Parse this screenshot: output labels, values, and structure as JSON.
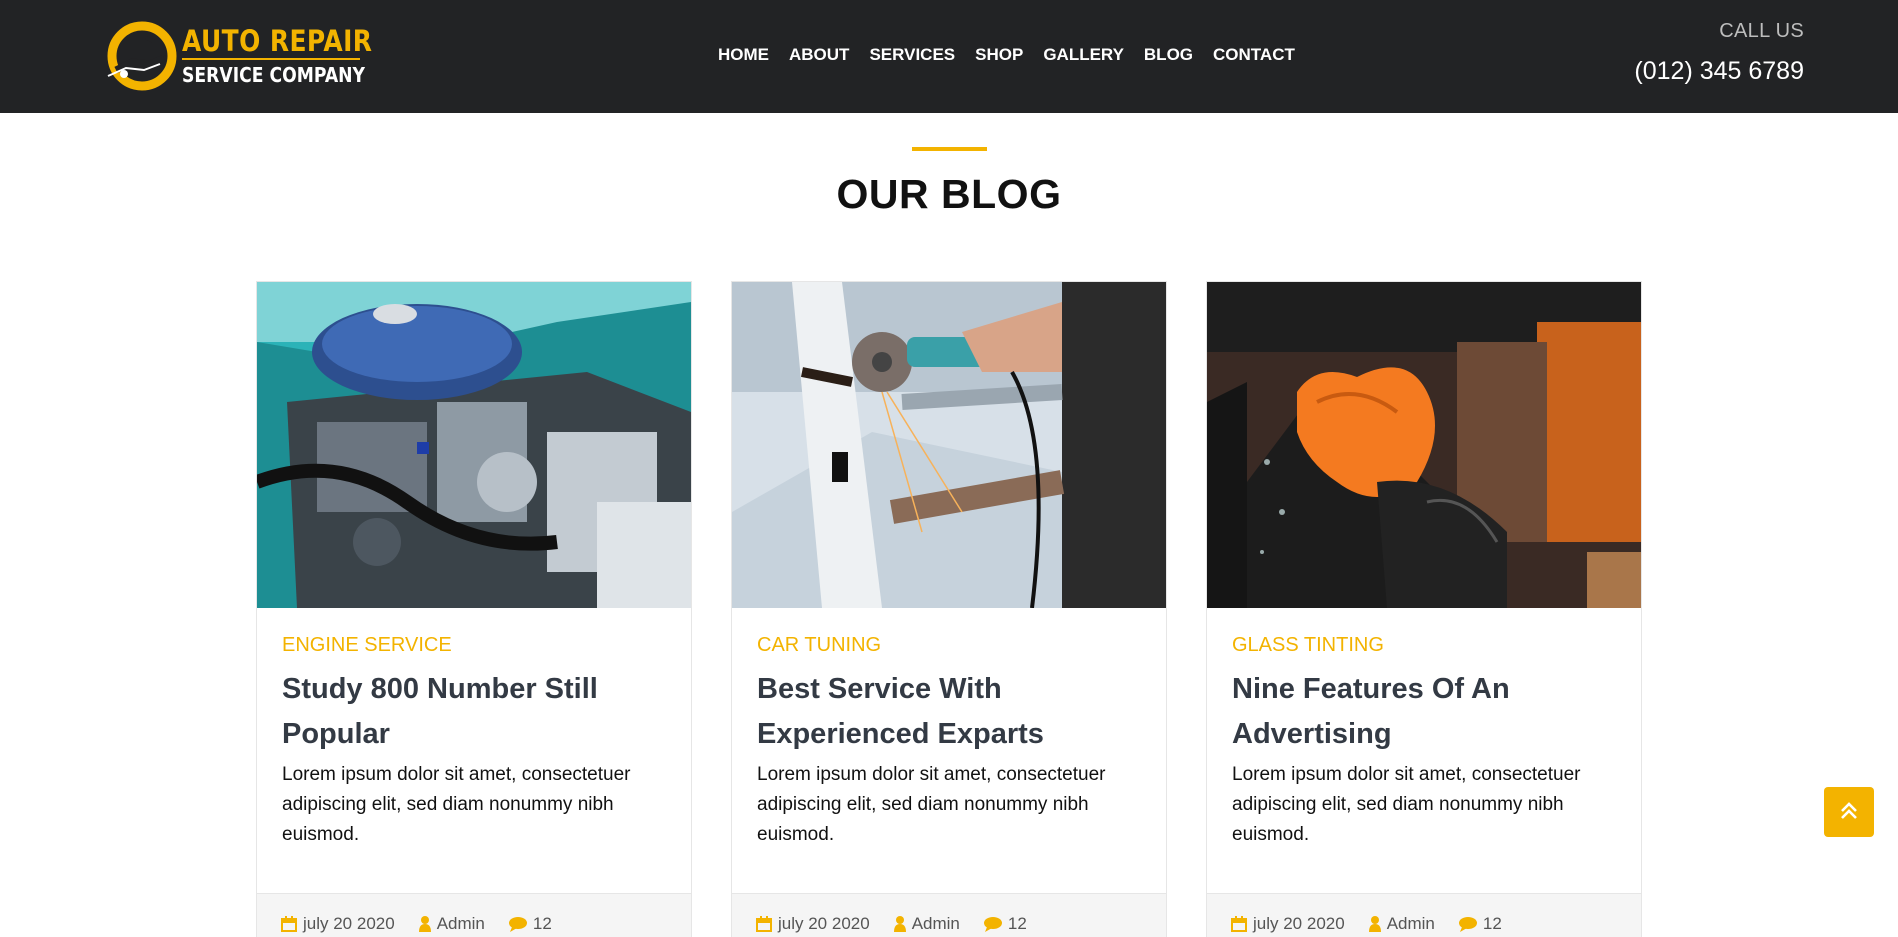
{
  "header": {
    "logo_line1": "AUTO REPAIR",
    "logo_line2": "SERVICE COMPANY",
    "nav": [
      "HOME",
      "ABOUT",
      "SERVICES",
      "SHOP",
      "GALLERY",
      "BLOG",
      "CONTACT"
    ],
    "call_label": "CALL US",
    "call_number": "(012) 345 6789"
  },
  "section": {
    "title": "OUR BLOG"
  },
  "posts": [
    {
      "category": "ENGINE SERVICE",
      "title": "Study 800 Number Still Popular",
      "excerpt": "Lorem ipsum dolor sit amet, consectetuer adipiscing elit, sed diam nonummy nibh euismod.",
      "date": "july 20 2020",
      "author": "Admin",
      "comments": "12"
    },
    {
      "category": "CAR TUNING",
      "title": "Best Service With Experienced Exparts",
      "excerpt": "Lorem ipsum dolor sit amet, consectetuer adipiscing elit, sed diam nonummy nibh euismod.",
      "date": "july 20 2020",
      "author": "Admin",
      "comments": "12"
    },
    {
      "category": "GLASS TINTING",
      "title": "Nine Features Of An Advertising",
      "excerpt": "Lorem ipsum dolor sit amet, consectetuer adipiscing elit, sed diam nonummy nibh euismod.",
      "date": "july 20 2020",
      "author": "Admin",
      "comments": "12"
    }
  ],
  "colors": {
    "accent": "#f3b300",
    "header_bg": "#222325",
    "heading": "#333a44"
  },
  "icons": {
    "date": "calendar-icon",
    "author": "user-icon",
    "comments": "comment-icon",
    "scroll_top": "double-chevron-up-icon"
  }
}
